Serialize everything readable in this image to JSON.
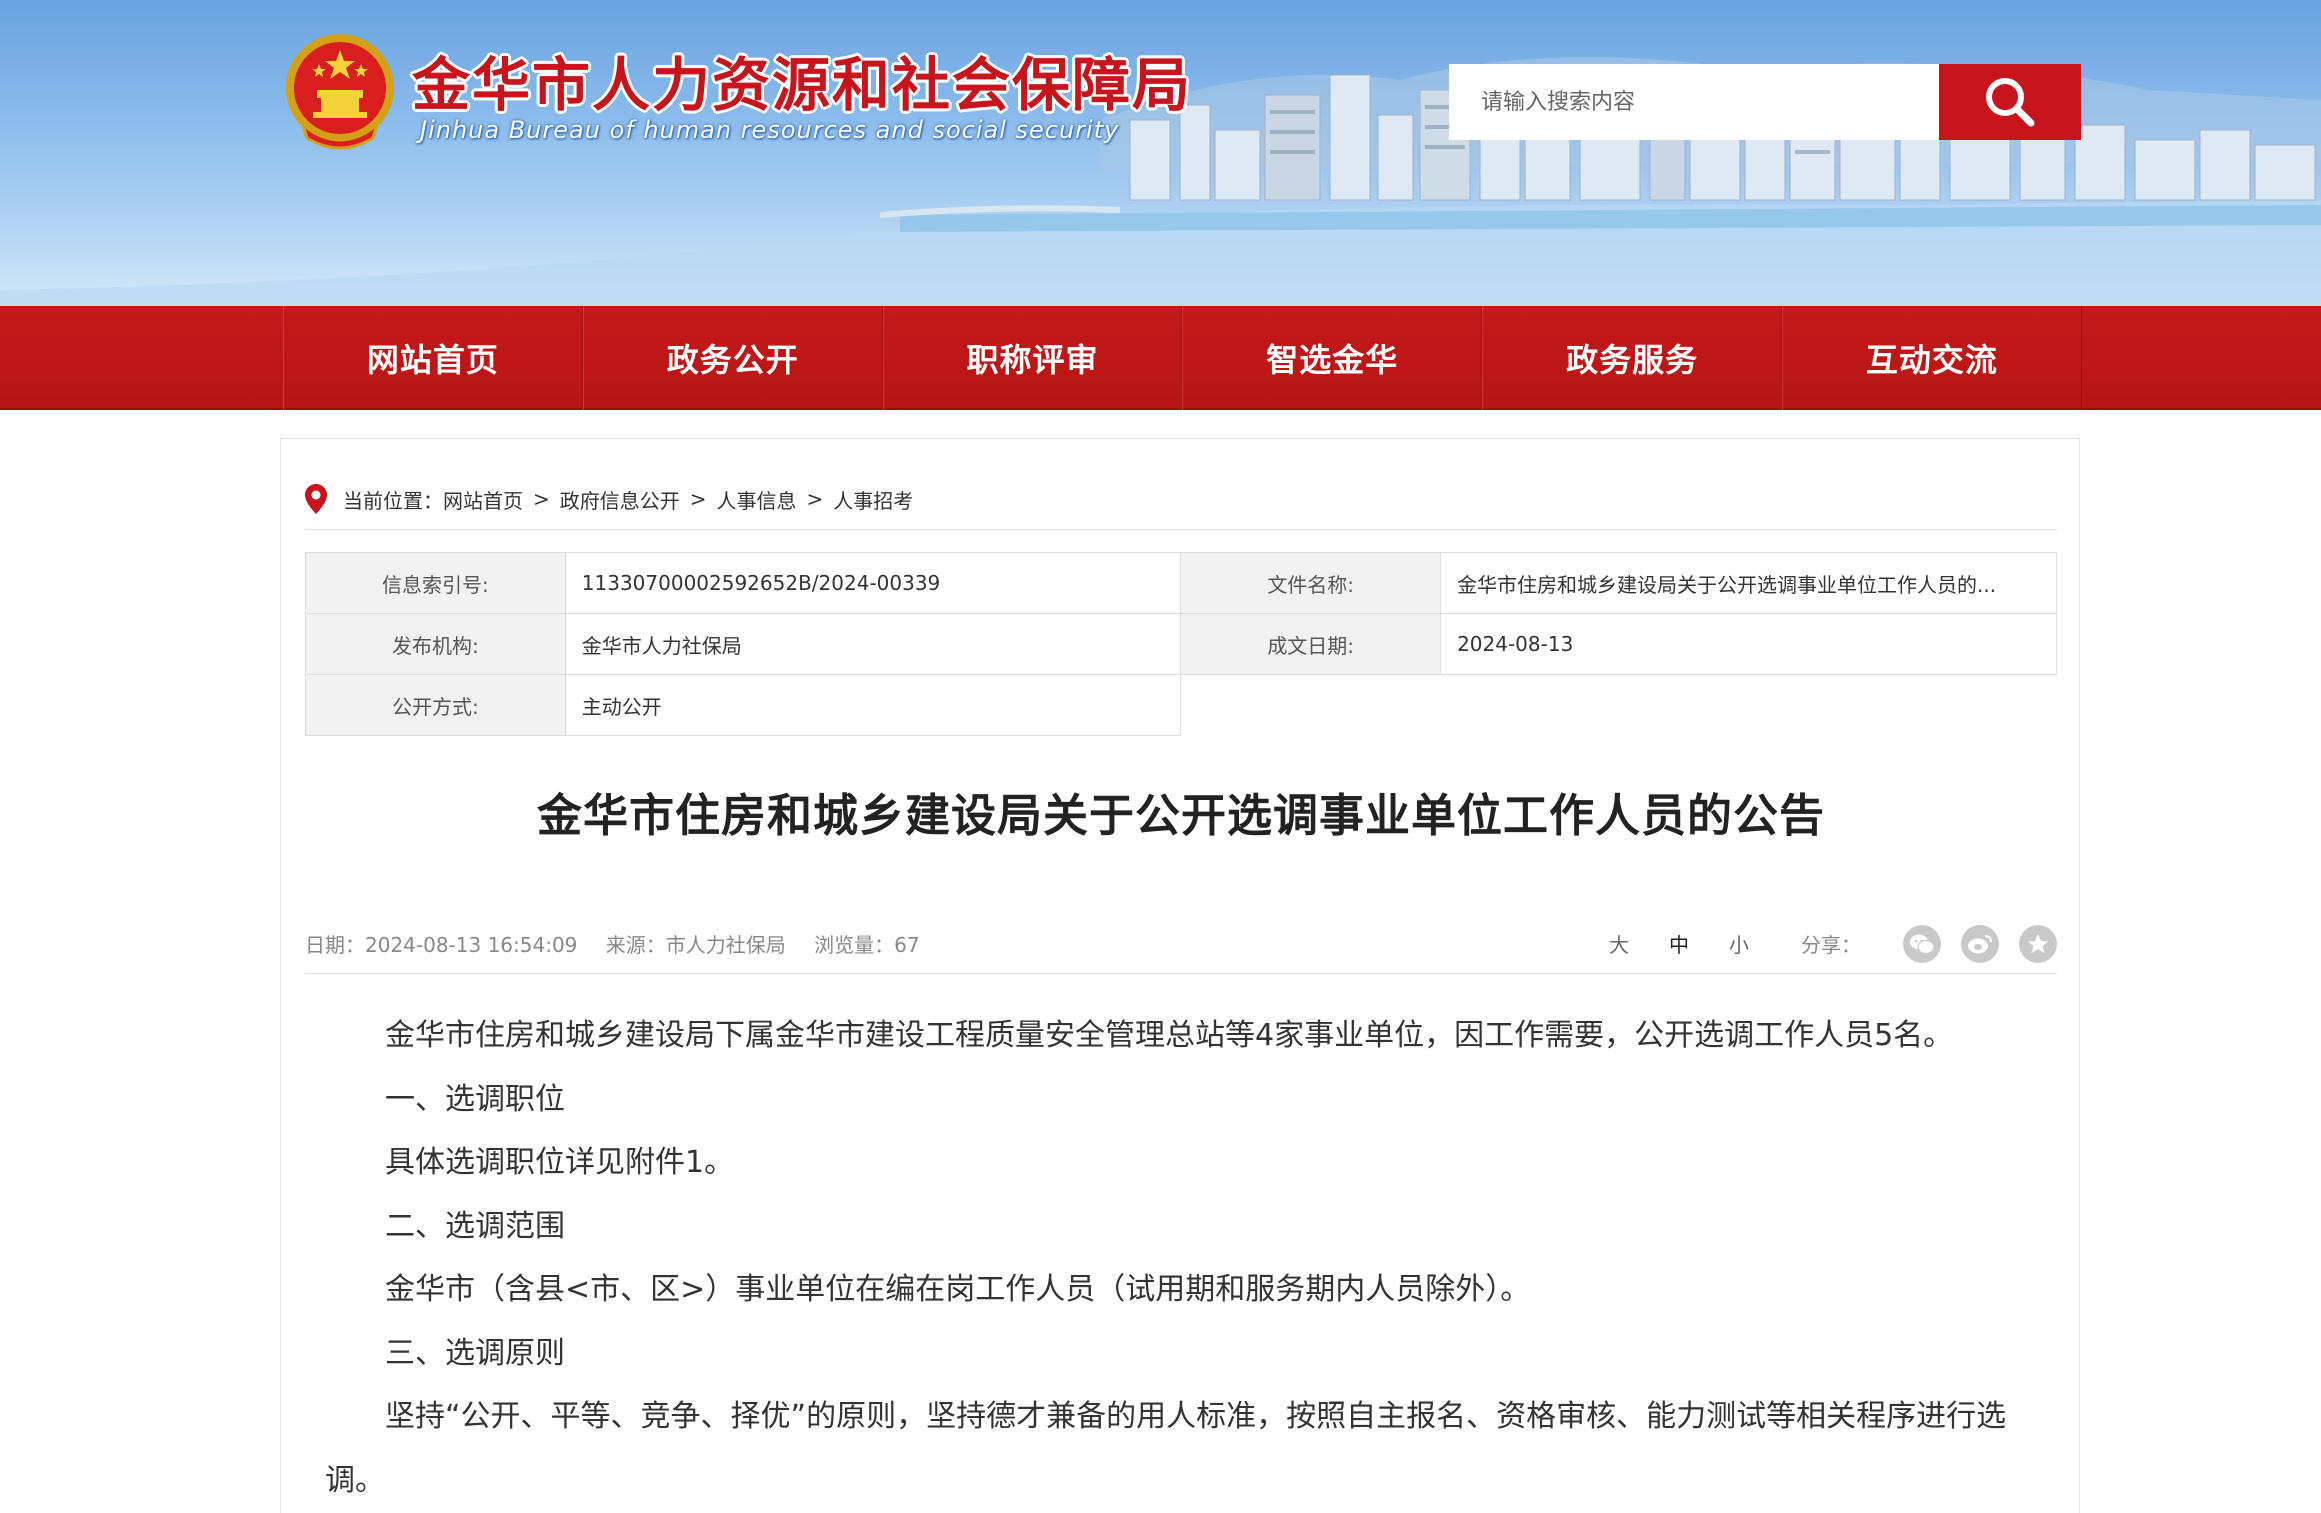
{
  "header": {
    "site_title": "金华市人力资源和社会保障局",
    "site_subtitle": "Jinhua Bureau of human resources and social security",
    "search_placeholder": "请输入搜索内容",
    "emblem_icon": "national-emblem-icon",
    "search_icon": "search-icon"
  },
  "nav": {
    "items": [
      {
        "label": "网站首页"
      },
      {
        "label": "政务公开"
      },
      {
        "label": "职称评审"
      },
      {
        "label": "智选金华"
      },
      {
        "label": "政务服务"
      },
      {
        "label": "互动交流"
      }
    ]
  },
  "breadcrumb": {
    "prefix": "当前位置：",
    "items": [
      "网站首页",
      "政府信息公开",
      "人事信息",
      "人事招考"
    ],
    "separator": ">"
  },
  "meta": {
    "index_label": "信息索引号:",
    "index_value": "11330700002592652B/2024-00339",
    "filename_label": "文件名称:",
    "filename_value": "金华市住房和城乡建设局关于公开选调事业单位工作人员的...",
    "publisher_label": "发布机构:",
    "publisher_value": "金华市人力社保局",
    "date_label": "成文日期:",
    "date_value": "2024-08-13",
    "method_label": "公开方式:",
    "method_value": "主动公开"
  },
  "article": {
    "title": "金华市住房和城乡建设局关于公开选调事业单位工作人员的公告",
    "date": "日期：2024-08-13 16:54:09",
    "source": "来源：市人力社保局",
    "views": "浏览量：67",
    "font_large": "大",
    "font_medium": "中",
    "font_small": "小",
    "share_label": "分享：",
    "paragraphs": [
      "金华市住房和城乡建设局下属金华市建设工程质量安全管理总站等4家事业单位，因工作需要，公开选调工作人员5名。",
      "一、选调职位",
      "具体选调职位详见附件1。",
      "二、选调范围",
      "金华市（含县<市、区>）事业单位在编在岗工作人员（试用期和服务期内人员除外）。",
      "三、选调原则",
      "坚持“公开、平等、竞争、择优”的原则，坚持德才兼备的用人标准，按照自主报名、资格审核、能力测试等相关程序进行选调。"
    ]
  },
  "colors": {
    "brand_red": "#c8151d",
    "nav_red": "#b81414"
  }
}
